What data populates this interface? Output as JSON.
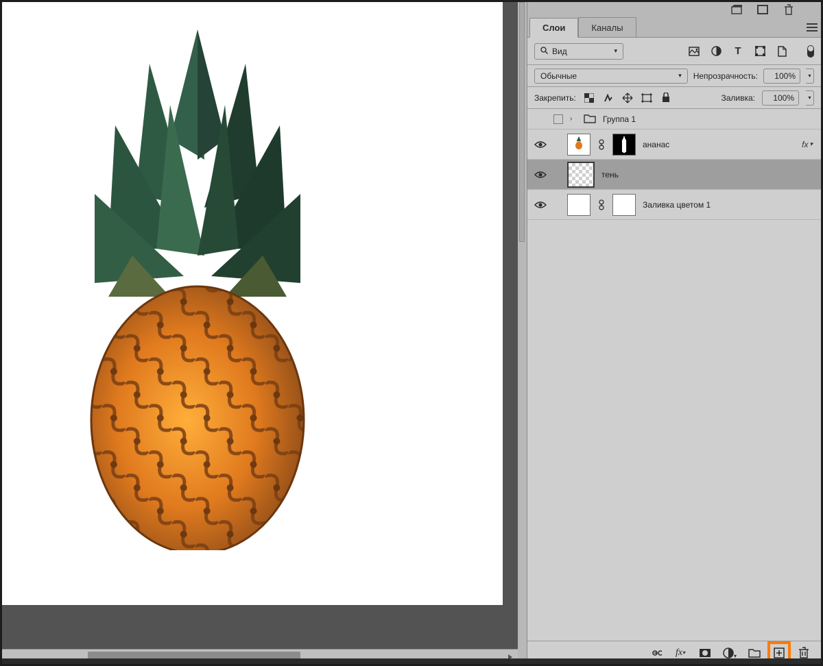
{
  "panel": {
    "tabs": {
      "layers": "Слои",
      "channels": "Каналы"
    },
    "filter": {
      "kind_label": "Вид"
    },
    "blend": {
      "mode": "Обычные",
      "opacity_label": "Непрозрачность:",
      "opacity_value": "100%"
    },
    "lock": {
      "label": "Закрепить:",
      "fill_label": "Заливка:",
      "fill_value": "100%"
    },
    "layers": {
      "group1": "Группа 1",
      "pineapple": "ананас",
      "shadow": "тень",
      "colorfill": "Заливка цветом 1",
      "fx": "fx"
    }
  }
}
